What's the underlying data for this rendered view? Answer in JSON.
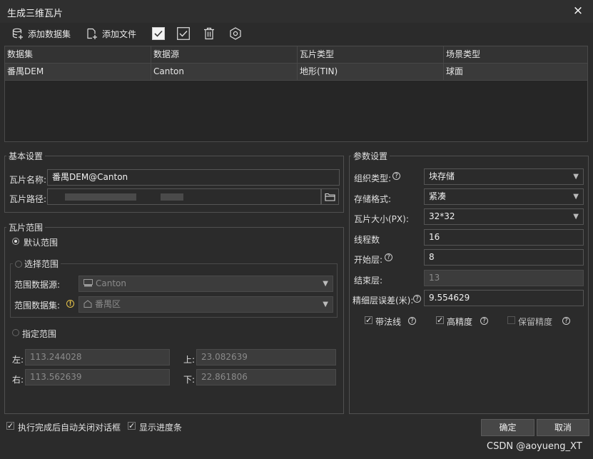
{
  "window": {
    "title": "生成三维瓦片",
    "close_icon": "×"
  },
  "toolbar": {
    "add_dataset": "添加数据集",
    "add_file": "添加文件"
  },
  "table": {
    "headers": [
      "数据集",
      "数据源",
      "瓦片类型",
      "场景类型"
    ],
    "rows": [
      [
        "番禺DEM",
        "Canton",
        "地形(TIN)",
        "球面"
      ]
    ]
  },
  "basic": {
    "title": "基本设置",
    "name_label": "瓦片名称:",
    "name_value": "番禺DEM@Canton",
    "path_label": "瓦片路径:"
  },
  "range": {
    "title": "瓦片范围",
    "default_label": "默认范围",
    "select_label": "选择范围",
    "ds_source_label": "范围数据源:",
    "ds_source_value": "Canton",
    "ds_set_label": "范围数据集:",
    "ds_set_value": "番禺区",
    "custom_label": "指定范围",
    "left_label": "左:",
    "left_value": "113.244028",
    "top_label": "上:",
    "top_value": "23.082639",
    "right_label": "右:",
    "right_value": "113.562639",
    "bottom_label": "下:",
    "bottom_value": "22.861806",
    "default_selected": true
  },
  "params": {
    "title": "参数设置",
    "org_label": "组织类型:",
    "org_value": "块存储",
    "fmt_label": "存储格式:",
    "fmt_value": "紧凑",
    "size_label": "瓦片大小(PX):",
    "size_value": "32*32",
    "thread_label": "线程数",
    "thread_value": "16",
    "start_label": "开始层:",
    "start_value": "8",
    "end_label": "结束层:",
    "end_value": "13",
    "err_label": "精细层误差(米):",
    "err_value": "9.554629",
    "normal_label": "带法线",
    "normal_checked": true,
    "hp_label": "高精度",
    "hp_checked": true,
    "keep_label": "保留精度",
    "keep_checked": false
  },
  "footer": {
    "auto_close_label": "执行完成后自动关闭对话框",
    "auto_close_checked": true,
    "progress_label": "显示进度条",
    "progress_checked": true,
    "ok": "确定",
    "cancel": "取消"
  },
  "watermark": "CSDN @aoyueng_XT",
  "colors": {
    "bg": "#2b2b2b",
    "field_border": "#555555",
    "warn": "#e6c34a"
  }
}
